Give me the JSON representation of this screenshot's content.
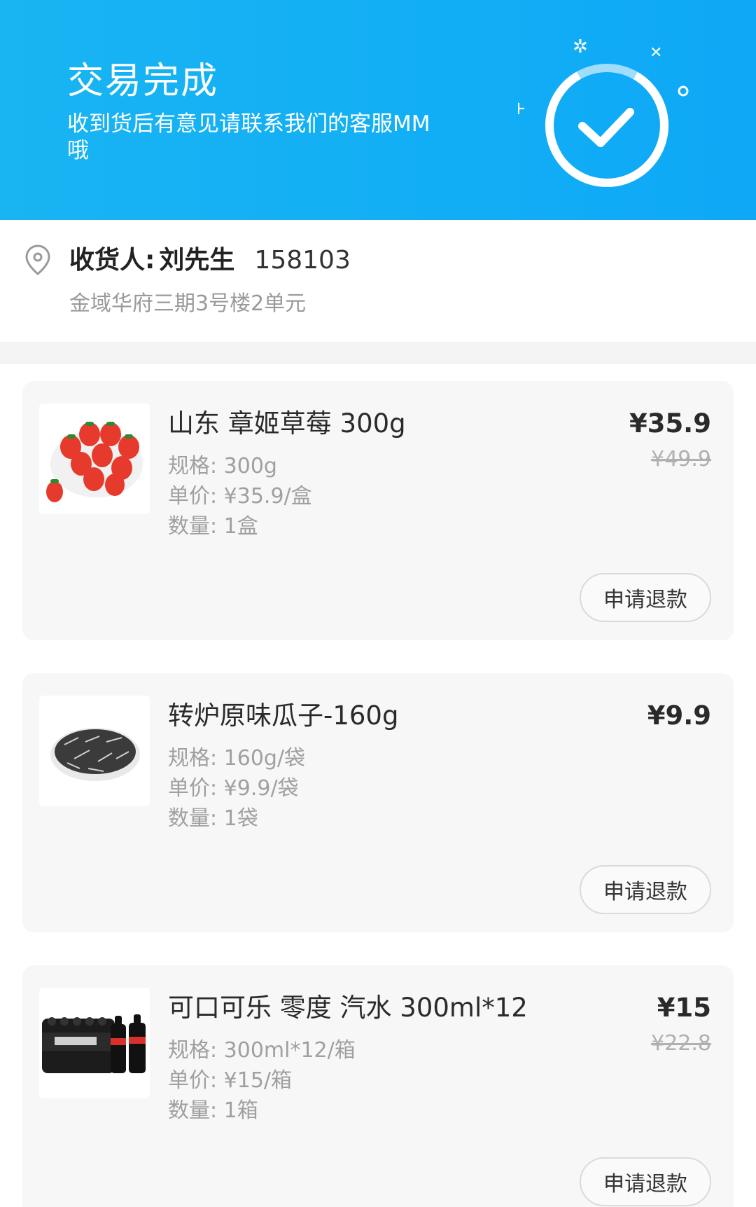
{
  "header": {
    "title": "交易完成",
    "subtitle": "收到货后有意见请联系我们的客服MM哦",
    "status_icon": "check-circle-icon",
    "accent_color": "#12aef5"
  },
  "address": {
    "icon": "location-pin-icon",
    "receiver_label": "收货人:",
    "receiver_name": "刘先生",
    "phone": "158103",
    "address_line": "金域华府三期3号楼2单元"
  },
  "products": [
    {
      "name": "山东 章姬草莓 300g",
      "spec": "规格: 300g",
      "unit_price": "单价: ¥35.9/盒",
      "quantity": "数量: 1盒",
      "price": "¥35.9",
      "old_price": "¥49.9",
      "refund_label": "申请退款",
      "image": "strawberry-image"
    },
    {
      "name": "转炉原味瓜子-160g",
      "spec": "规格: 160g/袋",
      "unit_price": "单价: ¥9.9/袋",
      "quantity": "数量: 1袋",
      "price": "¥9.9",
      "old_price": "",
      "refund_label": "申请退款",
      "image": "sunflower-seeds-image"
    },
    {
      "name": "可口可乐 零度 汽水 300ml*12",
      "spec": "规格: 300ml*12/箱",
      "unit_price": "单价: ¥15/箱",
      "quantity": "数量: 1箱",
      "price": "¥15",
      "old_price": "¥22.8",
      "refund_label": "申请退款",
      "image": "coke-zero-pack-image"
    }
  ]
}
